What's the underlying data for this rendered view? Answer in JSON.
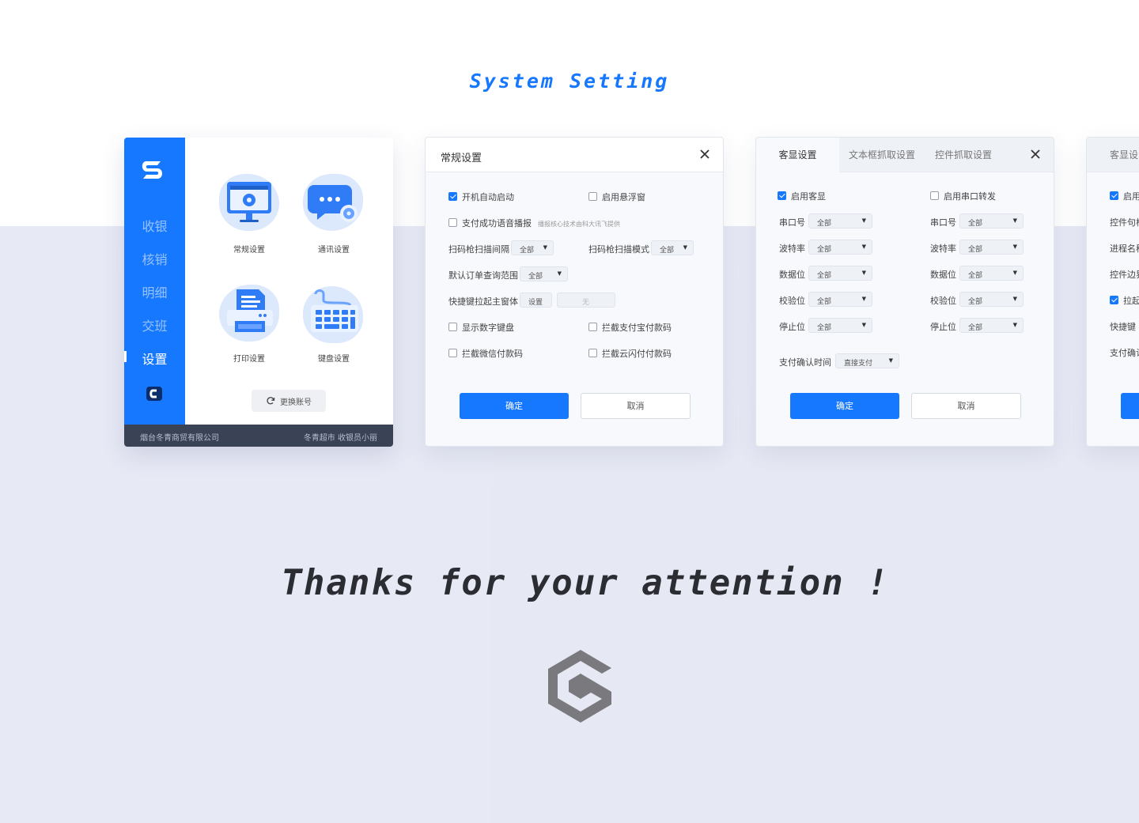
{
  "header": {
    "title": "System Setting"
  },
  "footer": {
    "thanks": "Thanks for your attention !"
  },
  "app": {
    "nav": [
      "收银",
      "核销",
      "明细",
      "交班",
      "设置"
    ],
    "active_nav": "设置",
    "tiles": [
      "常规设置",
      "通讯设置",
      "打印设置",
      "键盘设置"
    ],
    "switch_account": "更换账号",
    "company": "烟台冬青商贸有限公司",
    "store_user": "冬青超市 收银员小丽",
    "colors": {
      "primary": "#1677ff",
      "footer": "#3a4255"
    }
  },
  "general_dialog": {
    "title": "常规设置",
    "auto_start": "开机自动启动",
    "float_window": "启用悬浮窗",
    "voice_broadcast": "支付成功语音播报",
    "voice_hint": "播报核心技术由科大讯飞提供",
    "scan_interval": {
      "label": "扫码枪扫描间隔",
      "value": "全部"
    },
    "scan_mode": {
      "label": "扫码枪扫描模式",
      "value": "全部"
    },
    "order_range": {
      "label": "默认订单查询范围",
      "value": "全部"
    },
    "hotkey": {
      "label": "快捷键拉起主窗体",
      "button": "设置",
      "value": "无"
    },
    "numpad": "显示数字键盘",
    "block_alipay": "拦截支付宝付款码",
    "block_wechat": "拦截微信付款码",
    "block_unionpay": "拦截云闪付付款码",
    "ok": "确定",
    "cancel": "取消"
  },
  "display_dialog": {
    "tabs": [
      "客显设置",
      "文本框抓取设置",
      "控件抓取设置"
    ],
    "enable_display": "启用客显",
    "enable_forward": "启用串口转发",
    "fields": [
      "串口号",
      "波特率",
      "数据位",
      "校验位",
      "停止位"
    ],
    "field_value": "全部",
    "pay_confirm": {
      "label": "支付确认时间",
      "value": "直接支付"
    },
    "ok": "确定",
    "cancel": "取消"
  },
  "partial_dialog": {
    "tab": "客显设",
    "rows": [
      "启用",
      "控件句柄",
      "进程名称",
      "控件边界",
      "拉起",
      "快捷键",
      "支付确认"
    ]
  }
}
